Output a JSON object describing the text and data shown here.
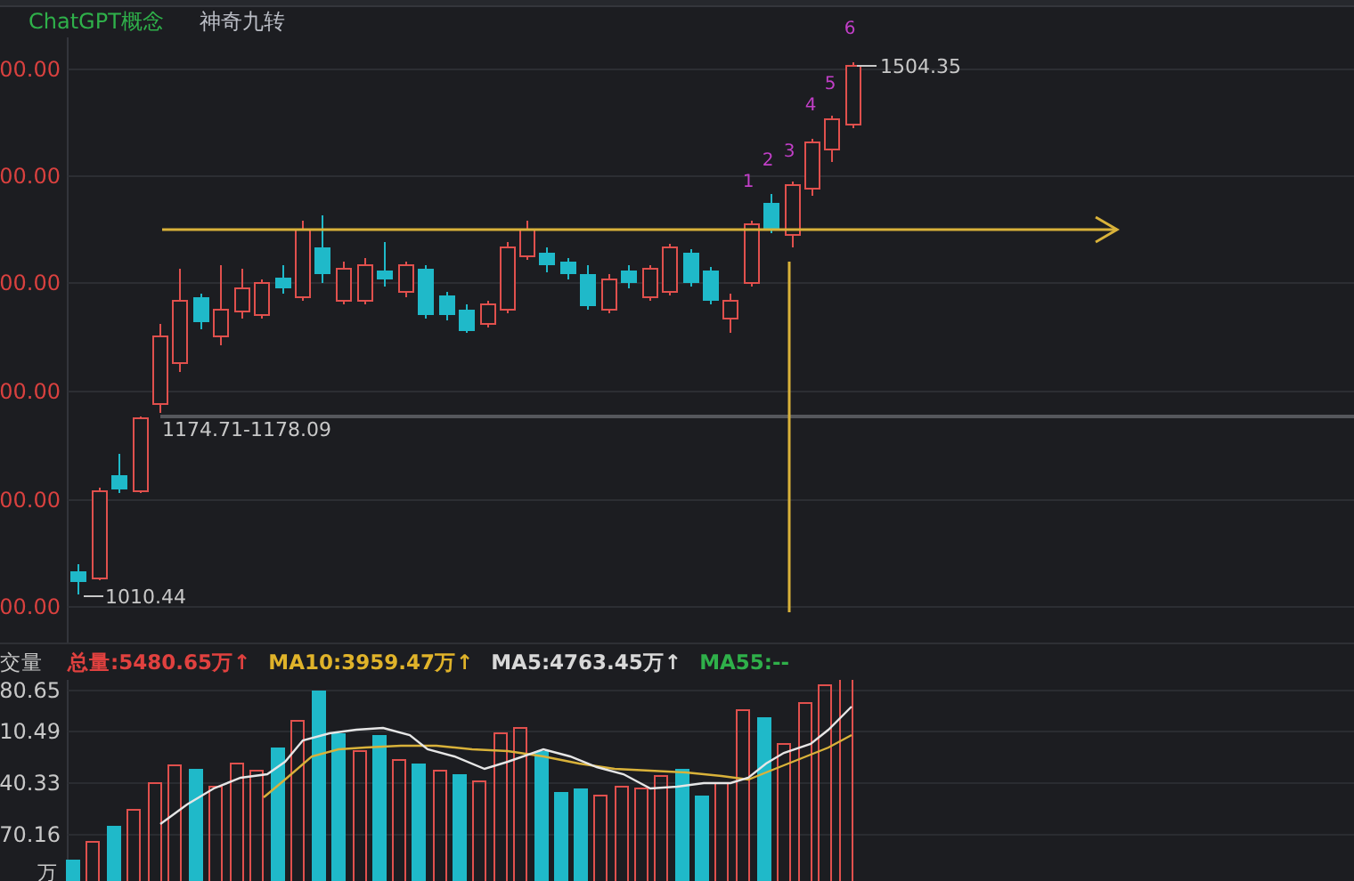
{
  "header": {
    "tags": [
      {
        "label": "ChatGPT概念",
        "color": "#2fb04a"
      },
      {
        "label": "神奇九转",
        "color": "#b9bcc4"
      }
    ]
  },
  "price_chart": {
    "axis_labels": [
      "00.00",
      "00.00",
      "00.00",
      "00.00",
      "00.00",
      "00.00"
    ],
    "high_label": "1504.35",
    "low_label": "1010.44",
    "range_label": "1174.71-1178.09",
    "count_labels": [
      "1",
      "2",
      "3",
      "4",
      "5",
      "6"
    ]
  },
  "volume": {
    "title": "交量",
    "stats": [
      {
        "label": "总量:5480.65万↑",
        "color": "#e0413f"
      },
      {
        "label": "MA10:3959.47万↑",
        "color": "#e0b32a"
      },
      {
        "label": "MA5:4763.45万↑",
        "color": "#d8d8d8"
      },
      {
        "label": "MA55:--",
        "color": "#2fb04a"
      }
    ],
    "axis_labels": [
      "80.65",
      "10.49",
      "40.33",
      "70.16"
    ],
    "unit": "万"
  }
}
